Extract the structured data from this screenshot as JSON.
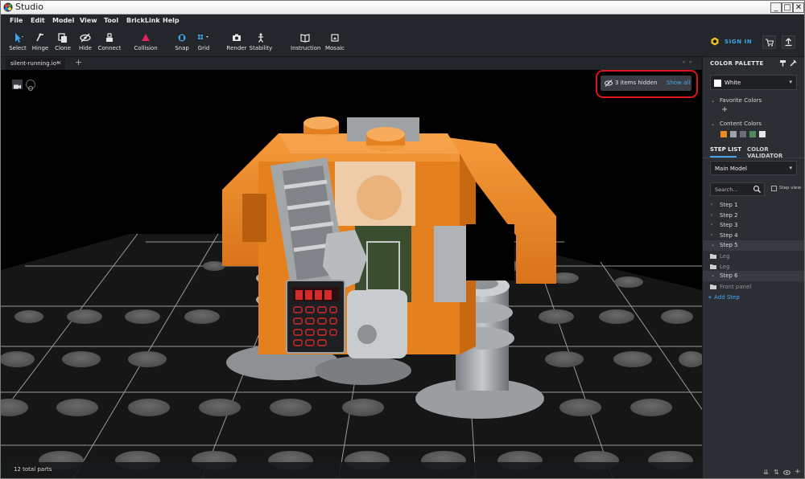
{
  "window": {
    "title": "Studio",
    "buttons": [
      "_",
      "□",
      "✕"
    ]
  },
  "menu": [
    "File",
    "Edit",
    "Model",
    "View",
    "Tool",
    "BrickLink",
    "Help"
  ],
  "toolbar": {
    "tools": [
      {
        "label": "Select",
        "icon": "cursor-icon"
      },
      {
        "label": "Hinge",
        "icon": "hinge-icon"
      },
      {
        "label": "Clone",
        "icon": "clone-icon"
      },
      {
        "label": "Hide",
        "icon": "hide-icon"
      },
      {
        "label": "Connect",
        "icon": "connect-icon"
      },
      {
        "label": "Collision",
        "icon": "collision-icon"
      },
      {
        "label": "Snap",
        "icon": "snap-icon"
      },
      {
        "label": "Grid",
        "icon": "grid-icon"
      },
      {
        "label": "Render",
        "icon": "camera-icon"
      },
      {
        "label": "Stability",
        "icon": "stability-icon"
      },
      {
        "label": "Instruction",
        "icon": "book-icon"
      },
      {
        "label": "Mosaic",
        "icon": "mosaic-icon"
      }
    ],
    "sign_in": "SIGN IN",
    "accent": "#3ea6e8"
  },
  "tab": {
    "name": "silent-running.io*",
    "close": "✕",
    "add": "+"
  },
  "viewport": {
    "hidden_items": "3 items hidden",
    "show_all": "Show all",
    "status": "12 total parts",
    "highlight_color": "#e0141c"
  },
  "panel": {
    "color_palette_title": "COLOR PALETTE",
    "selected_color": "White",
    "favorite_colors": "Favorite Colors",
    "add": "+",
    "content_colors": "Content Colors",
    "content_swatches": [
      "#f08a1e",
      "#9da3a6",
      "#6b6f73",
      "#4f8b5a",
      "#e6e6e6"
    ],
    "tabs": [
      "STEP LIST",
      "COLOR VALIDATOR"
    ],
    "model": "Main Model",
    "search_placeholder": "Search...",
    "step_view": "Step view",
    "steps": [
      {
        "kind": "step",
        "label": "Step 1",
        "open": false
      },
      {
        "kind": "step",
        "label": "Step 2",
        "open": false
      },
      {
        "kind": "step",
        "label": "Step 3",
        "open": false
      },
      {
        "kind": "step",
        "label": "Step 4",
        "open": false
      },
      {
        "kind": "step",
        "label": "Step 5",
        "open": true
      },
      {
        "kind": "part",
        "label": "Leg"
      },
      {
        "kind": "part",
        "label": "Leg"
      },
      {
        "kind": "step",
        "label": "Step 6",
        "open": true
      },
      {
        "kind": "part",
        "label": "Front panel"
      }
    ],
    "add_step": "+ Add Step"
  }
}
